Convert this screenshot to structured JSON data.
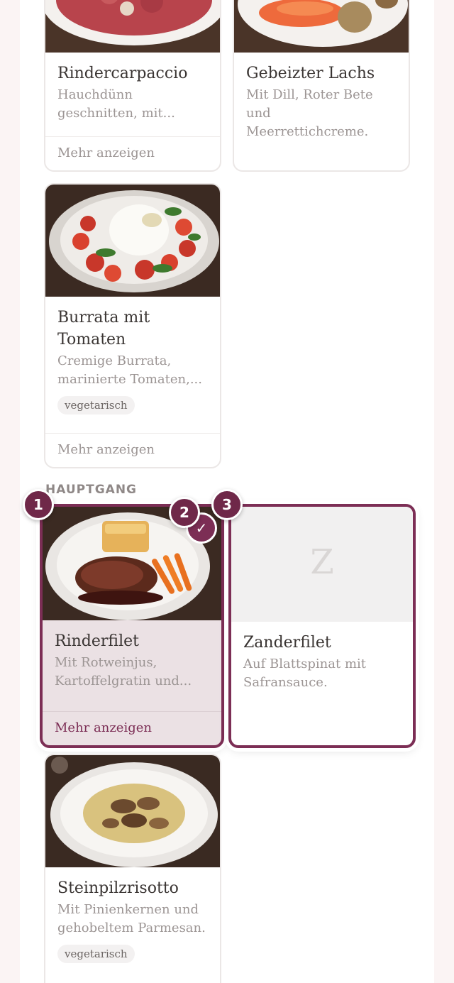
{
  "section": {
    "label": "HAUPTGANG"
  },
  "cards": {
    "carpaccio": {
      "title": "Rindercarpaccio",
      "desc_line1": "Hauchdünn",
      "desc_line2": "geschnitten, mit...",
      "more": "Mehr anzeigen"
    },
    "lachs": {
      "title": "Gebeizter Lachs",
      "desc_line1": "Mit Dill, Roter Bete",
      "desc_line2": "und Meerrettichcreme."
    },
    "burrata": {
      "title_line1": "Burrata mit",
      "title_line2": "Tomaten",
      "desc_line1": "Cremige Burrata,",
      "desc_line2": "marinierte Tomaten,...",
      "tag": "vegetarisch",
      "more": "Mehr anzeigen"
    },
    "rinderfilet": {
      "title": "Rinderfilet",
      "desc_line1": "Mit Rotweinjus,",
      "desc_line2": "Kartoffelgratin und...",
      "more": "Mehr anzeigen",
      "selected": true
    },
    "zanderfilet": {
      "title": "Zanderfilet",
      "desc_line1": "Auf Blattspinat mit",
      "desc_line2": "Safransauce.",
      "placeholder_letter": "Z"
    },
    "risotto": {
      "title": "Steinpilzrisotto",
      "desc_line1": "Mit Pinienkernen und",
      "desc_line2": "gehobeltem Parmesan.",
      "tag": "vegetarisch"
    }
  },
  "badges": [
    "1",
    "2",
    "3"
  ],
  "check_symbol": "✓",
  "colors": {
    "accent": "#7c2e55",
    "selected_bg": "#ebe1e4",
    "muted_text": "#9c9594"
  }
}
